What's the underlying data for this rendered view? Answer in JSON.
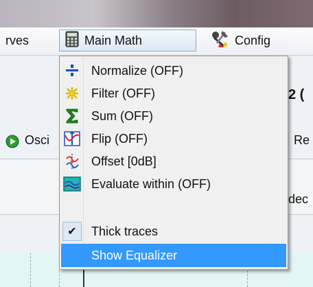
{
  "menubar": {
    "curves_label": "rves",
    "main_math_label": "Main Math",
    "config_label": "Config"
  },
  "background": {
    "frag_right_top": "2 (",
    "osc_label": "Osci",
    "frag_re": "Re",
    "frag_dec": "dec"
  },
  "dropdown": {
    "items": [
      {
        "label": "Normalize (OFF)",
        "icon": "normalize-icon"
      },
      {
        "label": "Filter (OFF)",
        "icon": "filter-icon"
      },
      {
        "label": "Sum (OFF)",
        "icon": "sum-icon"
      },
      {
        "label": "Flip (OFF)",
        "icon": "flip-icon"
      },
      {
        "label": "Offset [0dB]",
        "icon": "offset-icon"
      },
      {
        "label": "Evaluate within (OFF)",
        "icon": "evaluate-icon"
      },
      {
        "label": "Thick traces",
        "icon": "checkmark-icon",
        "checked": true
      },
      {
        "label": "Show Equalizer",
        "highlighted": true
      }
    ]
  },
  "colors": {
    "highlight": "#3399ff",
    "menu_bg": "#f0f0f0"
  }
}
